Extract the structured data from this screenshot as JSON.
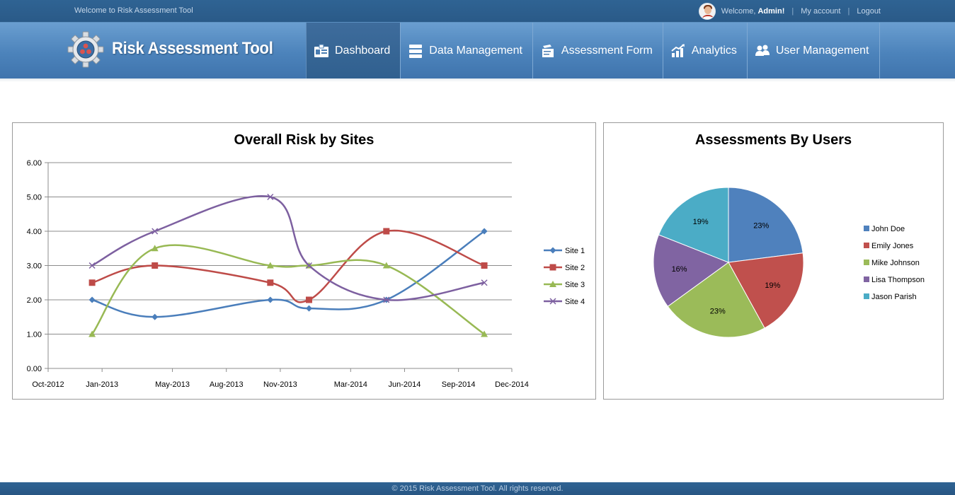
{
  "topbar": {
    "welcome_text": "Welcome to Risk Assessment Tool",
    "greeting": "Welcome,",
    "user_name": "Admin!",
    "my_account": "My account",
    "logout": "Logout",
    "separator": "|"
  },
  "header": {
    "brand": "Risk Assessment Tool",
    "nav": [
      {
        "label": "Dashboard",
        "icon": "dashboard-icon",
        "active": true
      },
      {
        "label": "Data Management",
        "icon": "database-icon",
        "active": false
      },
      {
        "label": "Assessment Form",
        "icon": "form-icon",
        "active": false
      },
      {
        "label": "Analytics",
        "icon": "analytics-icon",
        "active": false
      },
      {
        "label": "User Management",
        "icon": "users-icon",
        "active": false
      }
    ]
  },
  "chart_data": [
    {
      "type": "line",
      "title": "Overall Risk by Sites",
      "xlabel": "",
      "ylabel": "",
      "ylim": [
        0,
        6
      ],
      "y_ticks": [
        "0.00",
        "1.00",
        "2.00",
        "3.00",
        "4.00",
        "5.00",
        "6.00"
      ],
      "x_ticks": [
        "Oct-2012",
        "Jan-2013",
        "May-2013",
        "Aug-2013",
        "Nov-2013",
        "Mar-2014",
        "Jun-2014",
        "Sep-2014",
        "Dec-2014"
      ],
      "x_tick_dates": [
        "2012-10-01",
        "2013-01-01",
        "2013-05-01",
        "2013-08-01",
        "2013-11-01",
        "2014-03-01",
        "2014-06-01",
        "2014-09-01",
        "2014-12-01"
      ],
      "grid": true,
      "legend": "right",
      "smooth": true,
      "series": [
        {
          "name": "Site 1",
          "color": "#4a7ebb",
          "marker": "diamond",
          "points": [
            [
              "2012-12-15",
              2.0
            ],
            [
              "2013-04-01",
              1.5
            ],
            [
              "2013-10-15",
              2.0
            ],
            [
              "2013-12-20",
              1.75
            ],
            [
              "2014-05-01",
              2.0
            ],
            [
              "2014-10-15",
              4.0
            ]
          ]
        },
        {
          "name": "Site 2",
          "color": "#be4b48",
          "marker": "square",
          "points": [
            [
              "2012-12-15",
              2.5
            ],
            [
              "2013-04-01",
              3.0
            ],
            [
              "2013-10-15",
              2.5
            ],
            [
              "2013-12-20",
              2.0
            ],
            [
              "2014-05-01",
              4.0
            ],
            [
              "2014-10-15",
              3.0
            ]
          ]
        },
        {
          "name": "Site 3",
          "color": "#98b954",
          "marker": "triangle",
          "points": [
            [
              "2012-12-15",
              1.0
            ],
            [
              "2013-04-01",
              3.5
            ],
            [
              "2013-10-15",
              3.0
            ],
            [
              "2013-12-20",
              3.0
            ],
            [
              "2014-05-01",
              3.0
            ],
            [
              "2014-10-15",
              1.0
            ]
          ]
        },
        {
          "name": "Site 4",
          "color": "#7d60a0",
          "marker": "x",
          "points": [
            [
              "2012-12-15",
              3.0
            ],
            [
              "2013-04-01",
              4.0
            ],
            [
              "2013-10-15",
              5.0
            ],
            [
              "2013-12-20",
              3.0
            ],
            [
              "2014-05-01",
              2.0
            ],
            [
              "2014-10-15",
              2.5
            ]
          ]
        }
      ]
    },
    {
      "type": "pie",
      "title": "Assessments By Users",
      "legend": "right",
      "slices": [
        {
          "name": "John Doe",
          "value": 23,
          "label": "23%",
          "color": "#4f81bd"
        },
        {
          "name": "Emily Jones",
          "value": 19,
          "label": "19%",
          "color": "#c0504d"
        },
        {
          "name": "Mike Johnson",
          "value": 23,
          "label": "23%",
          "color": "#9bbb59"
        },
        {
          "name": "Lisa Thompson",
          "value": 16,
          "label": "16%",
          "color": "#8064a2"
        },
        {
          "name": "Jason Parish",
          "value": 19,
          "label": "19%",
          "color": "#4bacc6"
        }
      ]
    }
  ],
  "footer": {
    "text": "© 2015 Risk Assessment Tool. All rights reserved."
  }
}
